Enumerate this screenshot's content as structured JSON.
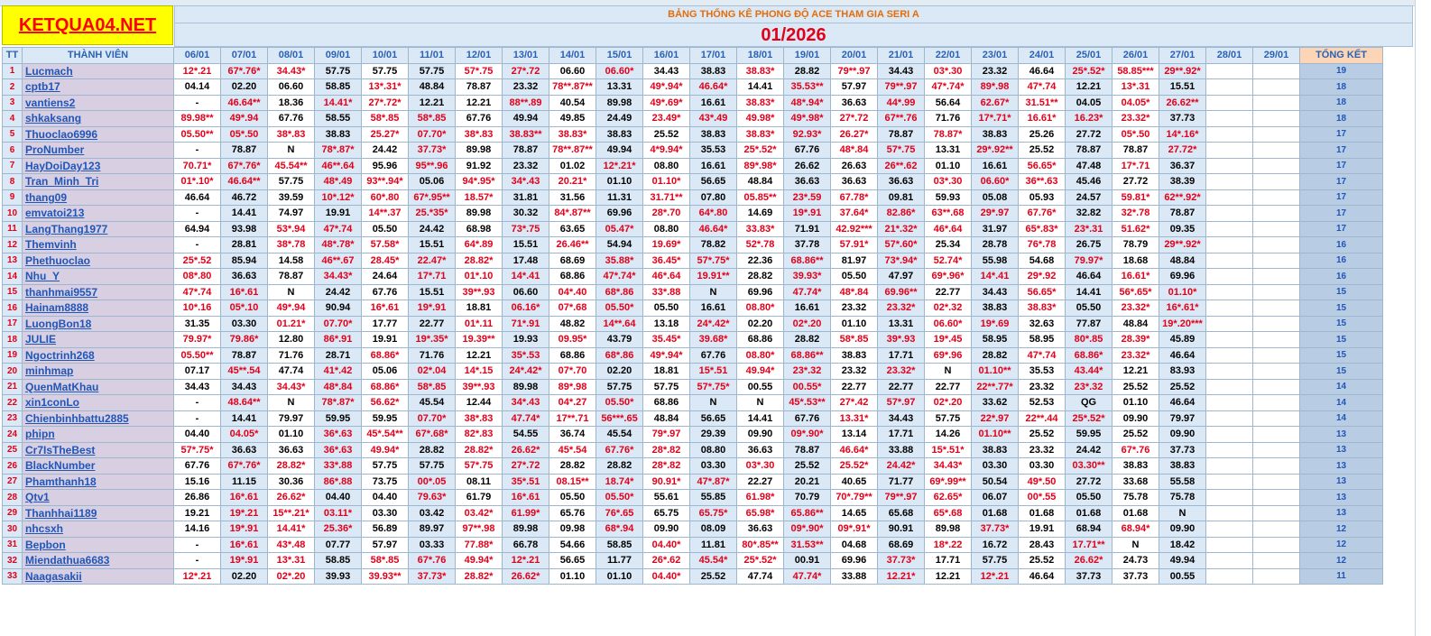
{
  "logo": "KETQUA04.NET",
  "banner": "BẢNG THỐNG KÊ PHONG ĐỘ ACE THAM GIA SERI A",
  "month": "01/2026",
  "headers": {
    "tt": "TT",
    "member": "THÀNH VIÊN",
    "total": "TỔNG KẾT"
  },
  "dates": [
    "06/01",
    "07/01",
    "08/01",
    "09/01",
    "10/01",
    "11/01",
    "12/01",
    "13/01",
    "14/01",
    "15/01",
    "16/01",
    "17/01",
    "18/01",
    "19/01",
    "20/01",
    "21/01",
    "22/01",
    "23/01",
    "24/01",
    "25/01",
    "26/01",
    "27/01",
    "28/01",
    "29/01"
  ],
  "rows": [
    {
      "tt": "1",
      "name": "Lucmach",
      "cells": [
        "12*.21",
        "67*.76*",
        "34.43*",
        "57.75",
        "57.75",
        "57.75",
        "57*.75",
        "27*.72",
        "06.60",
        "06.60*",
        "34.43",
        "38.83",
        "38.83*",
        "28.82",
        "79**.97",
        "34.43",
        "03*.30",
        "23.32",
        "46.64",
        "25*.52*",
        "58.85***",
        "29**.92*",
        "",
        ""
      ],
      "total": "19"
    },
    {
      "tt": "2",
      "name": "cptb17",
      "cells": [
        "04.14",
        "02.20",
        "06.60",
        "58.85",
        "13*.31*",
        "48.84",
        "78.87",
        "23.32",
        "78**.87**",
        "13.31",
        "49*.94*",
        "46.64*",
        "14.41",
        "35.53**",
        "57.97",
        "79**.97",
        "47*.74*",
        "89*.98",
        "47*.74",
        "12.21",
        "13*.31",
        "15.51",
        "",
        ""
      ],
      "total": "18"
    },
    {
      "tt": "3",
      "name": "vantiens2",
      "cells": [
        "-",
        "46.64**",
        "18.36",
        "14.41*",
        "27*.72*",
        "12.21",
        "12.21",
        "88**.89",
        "40.54",
        "89.98",
        "49*.69*",
        "16.61",
        "38.83*",
        "48*.94*",
        "36.63",
        "44*.99",
        "56.64",
        "62.67*",
        "31.51**",
        "04.05",
        "04.05*",
        "26.62**",
        "",
        ""
      ],
      "total": "18"
    },
    {
      "tt": "4",
      "name": "shkaksang",
      "cells": [
        "89.98**",
        "49*.94",
        "67.76",
        "58.55",
        "58*.85",
        "58*.85",
        "67.76",
        "49.94",
        "49.85",
        "24.49",
        "23.49*",
        "43*.49",
        "49.98*",
        "49*.98*",
        "27*.72",
        "67**.76",
        "71.76",
        "17*.71*",
        "16.61*",
        "16.23*",
        "23.32*",
        "37.73",
        "",
        ""
      ],
      "total": "18"
    },
    {
      "tt": "5",
      "name": "Thuoclao6996",
      "cells": [
        "05.50**",
        "05*.50",
        "38*.83",
        "38.83",
        "25.27*",
        "07.70*",
        "38*.83",
        "38.83**",
        "38.83*",
        "38.83",
        "25.52",
        "38.83",
        "38.83*",
        "92.93*",
        "26.27*",
        "78.87",
        "78.87*",
        "38.83",
        "25.26",
        "27.72",
        "05*.50",
        "14*.16*",
        "",
        ""
      ],
      "total": "17"
    },
    {
      "tt": "6",
      "name": "ProNumber",
      "cells": [
        "-",
        "78.87",
        "N",
        "78*.87*",
        "24.42",
        "37.73*",
        "89.98",
        "78.87",
        "78**.87**",
        "49.94",
        "4*9.94*",
        "35.53",
        "25*.52*",
        "67.76",
        "48*.84",
        "57*.75",
        "13.31",
        "29*.92**",
        "25.52",
        "78.87",
        "78.87",
        "27.72*",
        "",
        ""
      ],
      "total": "17"
    },
    {
      "tt": "7",
      "name": "HayDoiDay123",
      "cells": [
        "70.71*",
        "67*.76*",
        "45.54**",
        "46**.64",
        "95.96",
        "95**.96",
        "91.92",
        "23.32",
        "01.02",
        "12*.21*",
        "08.80",
        "16.61",
        "89*.98*",
        "26.62",
        "26.63",
        "26**.62",
        "01.10",
        "16.61",
        "56.65*",
        "47.48",
        "17*.71",
        "36.37",
        "",
        ""
      ],
      "total": "17"
    },
    {
      "tt": "8",
      "name": "Tran_Minh_Tri",
      "cells": [
        "01*.10*",
        "46.64**",
        "57.75",
        "48*.49",
        "93**.94*",
        "05.06",
        "94*.95*",
        "34*.43",
        "20.21*",
        "01.10",
        "01.10*",
        "56.65",
        "48.84",
        "36.63",
        "36.63",
        "36.63",
        "03*.30",
        "06.60*",
        "36**.63",
        "45.46",
        "27.72",
        "38.39",
        "",
        ""
      ],
      "total": "17"
    },
    {
      "tt": "9",
      "name": "thang09",
      "cells": [
        "46.64",
        "46.72",
        "39.59",
        "10*.12*",
        "60*.80",
        "67*.95**",
        "18.57*",
        "31.81",
        "31.56",
        "11.31",
        "31.71**",
        "07.80",
        "05.85**",
        "23*.59",
        "67.78*",
        "09.81",
        "59.93",
        "05.08",
        "05.93",
        "24.57",
        "59.81*",
        "62**.92*",
        "",
        ""
      ],
      "total": "17"
    },
    {
      "tt": "10",
      "name": "emvatoi213",
      "cells": [
        "-",
        "14.41",
        "74.97",
        "19.91",
        "14**.37",
        "25.*35*",
        "89.98",
        "30.32",
        "84*.87**",
        "69.96",
        "28*.70",
        "64*.80",
        "14.69",
        "19*.91",
        "37.64*",
        "82.86*",
        "63**.68",
        "29*.97",
        "67.76*",
        "32.82",
        "32*.78",
        "78.87",
        "",
        ""
      ],
      "total": "17"
    },
    {
      "tt": "11",
      "name": "LangThang1977",
      "cells": [
        "64.94",
        "93.98",
        "53*.94",
        "47*.74",
        "05.50",
        "24.42",
        "68.98",
        "73*.75",
        "63.65",
        "05.47*",
        "08.80",
        "46.64*",
        "33.83*",
        "71.91",
        "42.92***",
        "21*.32*",
        "46*.64",
        "31.97",
        "65*.83*",
        "23*.31",
        "51.62*",
        "09.35",
        "",
        ""
      ],
      "total": "17"
    },
    {
      "tt": "12",
      "name": "Themvinh",
      "cells": [
        "-",
        "28.81",
        "38*.78",
        "48*.78*",
        "57.58*",
        "15.51",
        "64*.89",
        "15.51",
        "26.46**",
        "54.94",
        "19.69*",
        "78.82",
        "52*.78",
        "37.78",
        "57.91*",
        "57*.60*",
        "25.34",
        "28.78",
        "76*.78",
        "26.75",
        "78.79",
        "29**.92*",
        "",
        ""
      ],
      "total": "16"
    },
    {
      "tt": "13",
      "name": "Phethuoclao",
      "cells": [
        "25*.52",
        "85.94",
        "14.58",
        "46**.67",
        "28.45*",
        "22.47*",
        "28.82*",
        "17.48",
        "68.69",
        "35.88*",
        "36.45*",
        "57*.75*",
        "22.36",
        "68.86**",
        "81.97",
        "73*.94*",
        "52.74*",
        "55.98",
        "54.68",
        "79.97*",
        "18.68",
        "48.84",
        "",
        ""
      ],
      "total": "16"
    },
    {
      "tt": "14",
      "name": "Nhu_Y",
      "cells": [
        "08*.80",
        "36.63",
        "78.87",
        "34.43*",
        "24.64",
        "17*.71",
        "01*.10",
        "14*.41",
        "68.86",
        "47*.74*",
        "46*.64",
        "19.91**",
        "28.82",
        "39.93*",
        "05.50",
        "47.97",
        "69*.96*",
        "14*.41",
        "29*.92",
        "46.64",
        "16.61*",
        "69.96",
        "",
        ""
      ],
      "total": "16"
    },
    {
      "tt": "15",
      "name": "thanhmai9557",
      "cells": [
        "47*.74",
        "16*.61",
        "N",
        "24.42",
        "67.76",
        "15.51",
        "39**.93",
        "06.60",
        "04*.40",
        "68*.86",
        "33*.88",
        "N",
        "69.96",
        "47.74*",
        "48*.84",
        "69.96**",
        "22.77",
        "34.43",
        "56.65*",
        "14.41",
        "56*.65*",
        "01.10*",
        "",
        ""
      ],
      "total": "15"
    },
    {
      "tt": "16",
      "name": "Hainam8888",
      "cells": [
        "10*.16",
        "05*.10",
        "49*.94",
        "90.94",
        "16*.61",
        "19*.91",
        "18.81",
        "06.16*",
        "07*.68",
        "05.50*",
        "05.50",
        "16.61",
        "08.80*",
        "16.61",
        "23.32",
        "23.32*",
        "02*.32",
        "38.83",
        "38.83*",
        "05.50",
        "23.32*",
        "16*.61*",
        "",
        ""
      ],
      "total": "15"
    },
    {
      "tt": "17",
      "name": "LuongBon18",
      "cells": [
        "31.35",
        "03.30",
        "01.21*",
        "07.70*",
        "17.77",
        "22.77",
        "01*.11",
        "71*.91",
        "48.82",
        "14**.64",
        "13.18",
        "24*.42*",
        "02.20",
        "02*.20",
        "01.10",
        "13.31",
        "06.60*",
        "19*.69",
        "32.63",
        "77.87",
        "48.84",
        "19*.20***",
        "",
        ""
      ],
      "total": "15"
    },
    {
      "tt": "18",
      "name": "JULIE",
      "cells": [
        "79.97*",
        "79.86*",
        "12.80",
        "86*.91",
        "19.91",
        "19*.35*",
        "19.39**",
        "19.93",
        "09.95*",
        "43.79",
        "35.45*",
        "39.68*",
        "68.86",
        "28.82",
        "58*.85",
        "39*.93",
        "19*.45",
        "58.95",
        "58.95",
        "80*.85",
        "28.39*",
        "45.89",
        "",
        ""
      ],
      "total": "15"
    },
    {
      "tt": "19",
      "name": "Ngoctrinh268",
      "cells": [
        "05.50**",
        "78.87",
        "71.76",
        "28.71",
        "68.86*",
        "71.76",
        "12.21",
        "35*.53",
        "68.86",
        "68*.86",
        "49*.94*",
        "67.76",
        "08.80*",
        "68.86**",
        "38.83",
        "17.71",
        "69*.96",
        "28.82",
        "47*.74",
        "68.86*",
        "23.32*",
        "46.64",
        "",
        ""
      ],
      "total": "15"
    },
    {
      "tt": "20",
      "name": "minhmap",
      "cells": [
        "07.17",
        "45**.54",
        "47.74",
        "41*.42",
        "05.06",
        "02*.04",
        "14*.15",
        "24*.42*",
        "07*.70",
        "02.20",
        "18.81",
        "15*.51",
        "49.94*",
        "23*.32",
        "23.32",
        "23.32*",
        "N",
        "01.10**",
        "35.53",
        "43.44*",
        "12.21",
        "83.93",
        "",
        ""
      ],
      "total": "15"
    },
    {
      "tt": "21",
      "name": "QuenMatKhau",
      "cells": [
        "34.43",
        "34.43",
        "34.43*",
        "48*.84",
        "68.86*",
        "58*.85",
        "39**.93",
        "89.98",
        "89*.98",
        "57.75",
        "57.75",
        "57*.75*",
        "00.55",
        "00.55*",
        "22.77",
        "22.77",
        "22.77",
        "22**.77*",
        "23.32",
        "23*.32",
        "25.52",
        "25.52",
        "",
        ""
      ],
      "total": "14"
    },
    {
      "tt": "22",
      "name": "xin1conLo",
      "cells": [
        "-",
        "48.64**",
        "N",
        "78*.87*",
        "56.62*",
        "45.54",
        "12.44",
        "34*.43",
        "04*.27",
        "05.50*",
        "68.86",
        "N",
        "N",
        "45*.53**",
        "27*.42",
        "57*.97",
        "02*.20",
        "33.62",
        "52.53",
        "QG",
        "01.10",
        "46.64",
        "",
        ""
      ],
      "total": "14"
    },
    {
      "tt": "23",
      "name": "Chienbinhbattu2885",
      "cells": [
        "-",
        "14.41",
        "79.97",
        "59.95",
        "59.95",
        "07.70*",
        "38*.83",
        "47.74*",
        "17**.71",
        "56***.65",
        "48.84",
        "56.65",
        "14.41",
        "67.76",
        "13.31*",
        "34.43",
        "57.75",
        "22*.97",
        "22**.44",
        "25*.52*",
        "09.90",
        "79.97",
        "",
        ""
      ],
      "total": "14"
    },
    {
      "tt": "24",
      "name": "phipn",
      "cells": [
        "04.40",
        "04.05*",
        "01.10",
        "36*.63",
        "45*.54**",
        "67*.68*",
        "82*.83",
        "54.55",
        "36.74",
        "45.54",
        "79*.97",
        "29.39",
        "09.90",
        "09*.90*",
        "13.14",
        "17.71",
        "14.26",
        "01.10**",
        "25.52",
        "59.95",
        "25.52",
        "09.90",
        "",
        ""
      ],
      "total": "13"
    },
    {
      "tt": "25",
      "name": "Cr7IsTheBest",
      "cells": [
        "57*.75*",
        "36.63",
        "36.63",
        "36*.63",
        "49.94*",
        "28.82",
        "28.82*",
        "26.62*",
        "45*.54",
        "67.76*",
        "28*.82",
        "08.80",
        "36.63",
        "78.87",
        "46.64*",
        "33.88",
        "15*.51*",
        "38.83",
        "23.32",
        "24.42",
        "67*.76",
        "37.73",
        "",
        ""
      ],
      "total": "13"
    },
    {
      "tt": "26",
      "name": "BlackNumber",
      "cells": [
        "67.76",
        "67*.76*",
        "28.82*",
        "33*.88",
        "57.75",
        "57.75",
        "57*.75",
        "27*.72",
        "28.82",
        "28.82",
        "28*.82",
        "03.30",
        "03*.30",
        "25.52",
        "25.52*",
        "24.42*",
        "34.43*",
        "03.30",
        "03.30",
        "03.30**",
        "38.83",
        "38.83",
        "",
        ""
      ],
      "total": "13"
    },
    {
      "tt": "27",
      "name": "Phamthanh18",
      "cells": [
        "15.16",
        "11.15",
        "30.36",
        "86*.88",
        "73.75",
        "00*.05",
        "08.11",
        "35*.51",
        "08.15**",
        "18.74*",
        "90.91*",
        "47*.87*",
        "22.27",
        "20.21",
        "40.65",
        "71.77",
        "69*.99**",
        "50.54",
        "49*.50",
        "27.72",
        "33.68",
        "55.58",
        "",
        ""
      ],
      "total": "13"
    },
    {
      "tt": "28",
      "name": "Qtv1",
      "cells": [
        "26.86",
        "16*.61",
        "26.62*",
        "04.40",
        "04.40",
        "79.63*",
        "61.79",
        "16*.61",
        "05.50",
        "05.50*",
        "55.61",
        "55.85",
        "61.98*",
        "70.79",
        "70*.79**",
        "79**.97",
        "62.65*",
        "06.07",
        "00*.55",
        "05.50",
        "75.78",
        "75.78",
        "",
        ""
      ],
      "total": "13"
    },
    {
      "tt": "29",
      "name": "Thanhhai1189",
      "cells": [
        "19.21",
        "19*.21",
        "15**.21*",
        "03.11*",
        "03.30",
        "03.42",
        "03.42*",
        "61.99*",
        "65.76",
        "76*.65",
        "65.75",
        "65.75*",
        "65.98*",
        "65.86**",
        "14.65",
        "65.68",
        "65*.68",
        "01.68",
        "01.68",
        "01.68",
        "01.68",
        "N",
        "",
        ""
      ],
      "total": "13"
    },
    {
      "tt": "30",
      "name": "nhcsxh",
      "cells": [
        "14.16",
        "19*.91",
        "14.41*",
        "25.36*",
        "56.89",
        "89.97",
        "97**.98",
        "89.98",
        "09.98",
        "68*.94",
        "09.90",
        "08.09",
        "36.63",
        "09*.90*",
        "09*.91*",
        "90.91",
        "89.98",
        "37.73*",
        "19.91",
        "68.94",
        "68.94*",
        "09.90",
        "",
        ""
      ],
      "total": "12"
    },
    {
      "tt": "31",
      "name": "Bepbon",
      "cells": [
        "-",
        "16*.61",
        "43*.48",
        "07.77",
        "57.97",
        "03.33",
        "77.88*",
        "66.78",
        "54.66",
        "58.85",
        "04.40*",
        "11.81",
        "80*.85**",
        "31.53**",
        "04.68",
        "68.69",
        "18*.22",
        "16.72",
        "28.43",
        "17.71**",
        "N",
        "18.42",
        "",
        ""
      ],
      "total": "12"
    },
    {
      "tt": "32",
      "name": "Miendathua6683",
      "cells": [
        "-",
        "19*.91",
        "13*.31",
        "58.85",
        "58*.85",
        "67*.76",
        "49.94*",
        "12*.21",
        "56.65",
        "11.77",
        "26*.62",
        "45.54*",
        "25*.52*",
        "00.91",
        "69.96",
        "37.73*",
        "17.71",
        "57.75",
        "25.52",
        "26.62*",
        "24.73",
        "49.94",
        "",
        ""
      ],
      "total": "12"
    },
    {
      "tt": "33",
      "name": "Naagasakii",
      "cells": [
        "12*.21",
        "02.20",
        "02*.20",
        "39.93",
        "39.93**",
        "37.73*",
        "28.82*",
        "26.62*",
        "01.10",
        "01.10",
        "04.40*",
        "25.52",
        "47.74",
        "47.74*",
        "33.88",
        "12.21*",
        "12.21",
        "12*.21",
        "46.64",
        "37.73",
        "37.73",
        "00.55",
        "",
        ""
      ],
      "total": "11"
    }
  ]
}
